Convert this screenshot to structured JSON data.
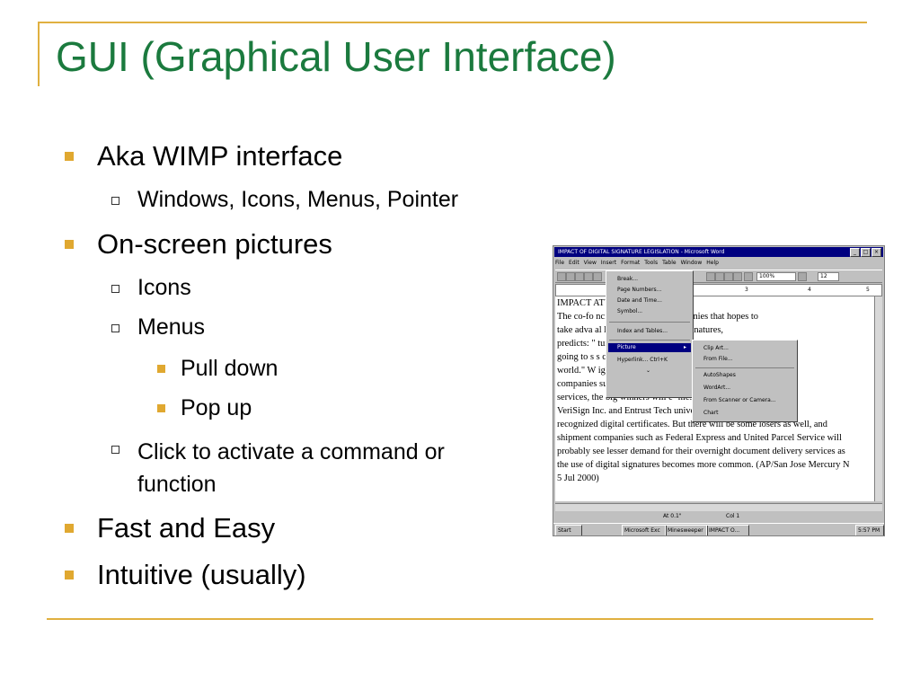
{
  "title": "GUI (Graphical User Interface)",
  "bullets": {
    "aka": "Aka WIMP interface",
    "wimp": "Windows, Icons, Menus, Pointer",
    "onscreen": "On-screen pictures",
    "icons": "Icons",
    "menus": "Menus",
    "pulldown": "Pull down",
    "popup": "Pop up",
    "click_line1": "Click to activate a command or",
    "click_line2": "function",
    "fast": "Fast and Easy",
    "intuitive": "Intuitive (usually)"
  },
  "screenshot": {
    "window_title": "IMPACT OF DIGITAL SIGNATURE LEGISLATION - Microsoft Word",
    "menus": [
      "File",
      "Edit",
      "View",
      "Insert",
      "Format",
      "Tools",
      "Table",
      "Window",
      "Help"
    ],
    "zoom": "100%",
    "font_size": "12",
    "ruler": [
      "1",
      "2",
      "3",
      "4",
      "5"
    ],
    "doc_lines": [
      "IMPACT                                    ATURE LEGISLATION",
      "The co-fo                          nc., one of the tiny companies that hopes to",
      "take adva                          al legislation on digital signatures,",
      "predicts: \"                                                  tures. You're",
      "going to s                                                   s change the",
      "world.\" W                                                   ignatures? Besides",
      "companies such as signOnline,                           re technologies and",
      "services, the big winners will e-                        nies such as",
      "VeriSign Inc. and Entrust Tech                          universally",
      "recognized digital certificates. But there will be some losers as well, and",
      "shipment companies such as Federal Express and United Parcel Service will",
      "probably see lesser demand for their overnight document delivery services as",
      "the use of digital signatures becomes more common. (AP/San Jose Mercury N",
      "5 Jul 2000)"
    ],
    "insert_menu": [
      "Break...",
      "Page Numbers...",
      "Date and Time...",
      "Symbol...",
      "Index and Tables...",
      "Picture",
      "Hyperlink...   Ctrl+K"
    ],
    "picture_menu": [
      "Clip Art...",
      "From File...",
      "AutoShapes",
      "WordArt...",
      "From Scanner or Camera...",
      "Chart"
    ],
    "status": {
      "at": "At 0.1\"",
      "col": "Col 1"
    },
    "taskbar": {
      "start": "Start",
      "tasks": [
        "Microsoft Exc",
        "Minesweeper",
        "IMPACT O..."
      ],
      "clock": "5:57 PM"
    }
  }
}
